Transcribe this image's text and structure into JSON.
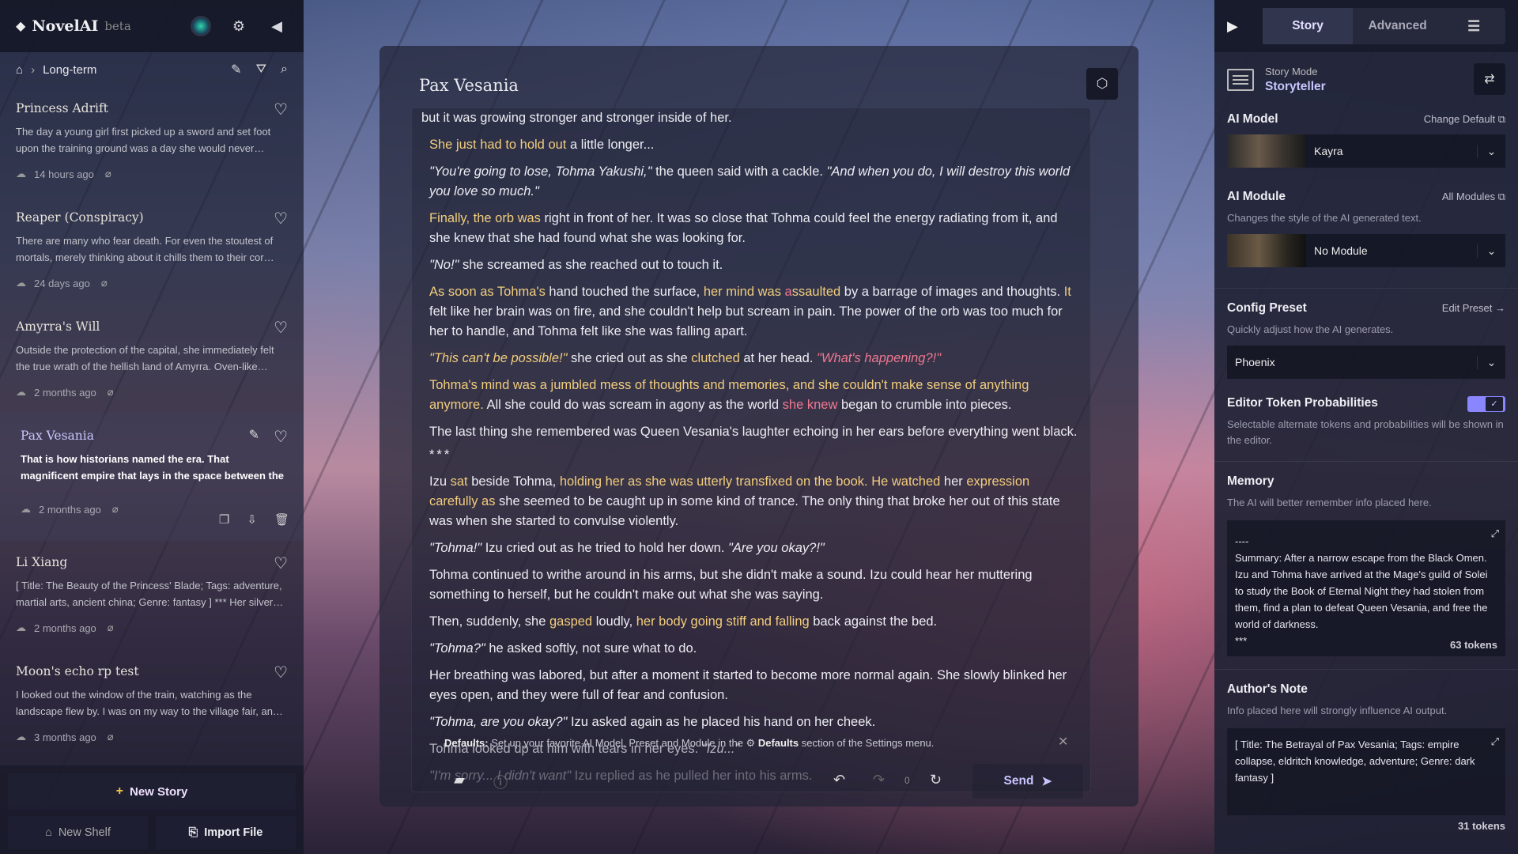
{
  "app": {
    "name": "NovelAI",
    "badge": "beta"
  },
  "sidebar": {
    "breadcrumb": "Long-term",
    "stories": [
      {
        "title": "Princess Adrift",
        "desc": "The day a young girl first picked up a sword and set foot upon the training ground was a day she would never…",
        "time": "14 hours ago"
      },
      {
        "title": "Reaper (Conspiracy)",
        "desc": "There are many who fear death. For even the stoutest of mortals, merely thinking about it chills them to their cor…",
        "time": "24 days ago"
      },
      {
        "title": "Amyrra's Will",
        "desc": "Outside the protection of the capital, she immediately felt the true wrath of the hellish land of Amyrra. Oven-like…",
        "time": "2 months ago"
      },
      {
        "title": "Pax Vesania",
        "desc": "That is how historians named the era. That magnificent empire that lays in the space between the human mi…",
        "time": "2 months ago"
      },
      {
        "title": "Li Xiang",
        "desc": "[ Title: The Beauty of the Princess' Blade; Tags: adventure, martial arts, ancient china; Genre: fantasy ] *** Her silver…",
        "time": "2 months ago"
      },
      {
        "title": "Moon's echo rp test",
        "desc": "I looked out the window of the train, watching as the landscape flew by. I was on my way to the village fair, an…",
        "time": "3 months ago"
      }
    ],
    "new_story": "New Story",
    "new_shelf": "New Shelf",
    "import_file": "Import File"
  },
  "editor": {
    "title": "Pax Vesania",
    "lines": {
      "l0": "but it was growing stronger and stronger inside of her.",
      "l1a": "She just had to hold out",
      "l1b": " a little longer...",
      "l2a": "\"You're going to lose, Tohma Yakushi,\"",
      "l2b": " the queen said with a cackle. ",
      "l2c": "\"And when you do, I will destroy this world you love so much.\"",
      "l3a": "Finally, the orb was",
      "l3b": " right in front of her. It was so close that Tohma could feel the energy radiating from it, and she knew that she had found what she was looking for.",
      "l4a": "\"No!\"",
      "l4b": " she screamed as she reached out to touch it.",
      "l5a": "As soon as Tohma's",
      "l5b": " hand touched the surface, ",
      "l5c": "her mind was ",
      "l5d": "a",
      "l5e": "ssaulted",
      "l5f": " by a barrage of images and thoughts. ",
      "l5g": "It",
      "l5h": " felt like her brain was on fire, and she couldn't help but scream in pain. The power of the orb was too much for her to handle, and Tohma felt like she was falling apart.",
      "l6a": "\"This can't be possible!\"",
      "l6b": " she cried out as she ",
      "l6c": "clutched",
      "l6d": " at her head. ",
      "l6e": "\"What's happening?!\"",
      "l7a": "Tohma's mind was a jumbled mess of thoughts and memories, and she couldn't make sense of anything anymore.",
      "l7b": " All she could do was scream in agony as the world ",
      "l7c": "she knew",
      "l7d": " began to crumble into pieces.",
      "l8": "The last thing she remembered was Queen Vesania's laughter echoing in her ears before everything went black.",
      "l9": "***",
      "l10a": "Izu ",
      "l10b": "sat",
      "l10c": " beside Tohma, ",
      "l10d": "holding her as she was utterly transfixed on the book. He watched",
      "l10e": " her ",
      "l10f": "expression carefully as",
      "l10g": " she seemed to be caught up in some kind of trance. The only thing that broke her out of this state was when she started to convulse violently.",
      "l11a": "\"Tohma!\"",
      "l11b": " Izu cried out as he tried to hold her down. ",
      "l11c": "\"Are you okay?!\"",
      "l12": "Tohma continued to writhe around in his arms, but she didn't make a sound. Izu could hear her muttering something to herself, but he couldn't make out what she was saying.",
      "l13a": "Then, suddenly, she ",
      "l13b": "gasped",
      "l13c": " loudly, ",
      "l13d": "her body going stiff and falling",
      "l13e": " back against the bed.",
      "l14a": "\"Tohma?\"",
      "l14b": " he asked softly, not sure what to do.",
      "l15": "Her breathing was labored, but after a moment it started to become more normal again. She slowly blinked her eyes open, and they were full of fear and confusion.",
      "l16a": "\"Tohma, are you okay?\"",
      "l16b": " Izu asked again as he placed his hand on her cheek.",
      "l17a": "Tohma looked up at him with tears in her eyes. ",
      "l17b": "\"Izu...\"",
      "l18a": "\"I'm sorry... I didn't want\"",
      "l18b": " Izu replied as he pulled her into his arms."
    },
    "defaults_label": "Defaults:",
    "defaults_text": " Set up your favorite AI Model, Preset and Module in the ",
    "defaults_bold": "Defaults",
    "defaults_tail": " section of the Settings menu.",
    "retry_count": "0",
    "send": "Send"
  },
  "right": {
    "tabs": [
      "Story",
      "Advanced"
    ],
    "story_mode_label": "Story Mode",
    "story_mode_value": "Storyteller",
    "ai_model": {
      "title": "AI Model",
      "link": "Change Default",
      "value": "Kayra"
    },
    "ai_module": {
      "title": "AI Module",
      "link": "All Modules",
      "sub": "Changes the style of the AI generated text.",
      "value": "No Module"
    },
    "config_preset": {
      "title": "Config Preset",
      "link": "Edit Preset",
      "sub": "Quickly adjust how the AI generates.",
      "value": "Phoenix"
    },
    "token_probs": {
      "title": "Editor Token Probabilities",
      "sub": "Selectable alternate tokens and probabilities will be shown in the editor."
    },
    "memory": {
      "title": "Memory",
      "sub": "The AI will better remember info placed here.",
      "dash": "----",
      "text": "Summary: After a narrow escape from the Black Omen. Izu and Tohma have arrived at the Mage's guild of Solei to study the Book of Eternal Night they had stolen from them, find a plan to defeat Queen Vesania, and free the world of darkness.",
      "stars": "***",
      "tokens": "63 tokens"
    },
    "authors_note": {
      "title": "Author's Note",
      "sub": "Info placed here will strongly influence AI output.",
      "text": "[ Title: The Betrayal of Pax Vesania; Tags: empire collapse, eldritch knowledge, adventure; Genre: dark fantasy ]",
      "tokens": "31 tokens"
    }
  }
}
